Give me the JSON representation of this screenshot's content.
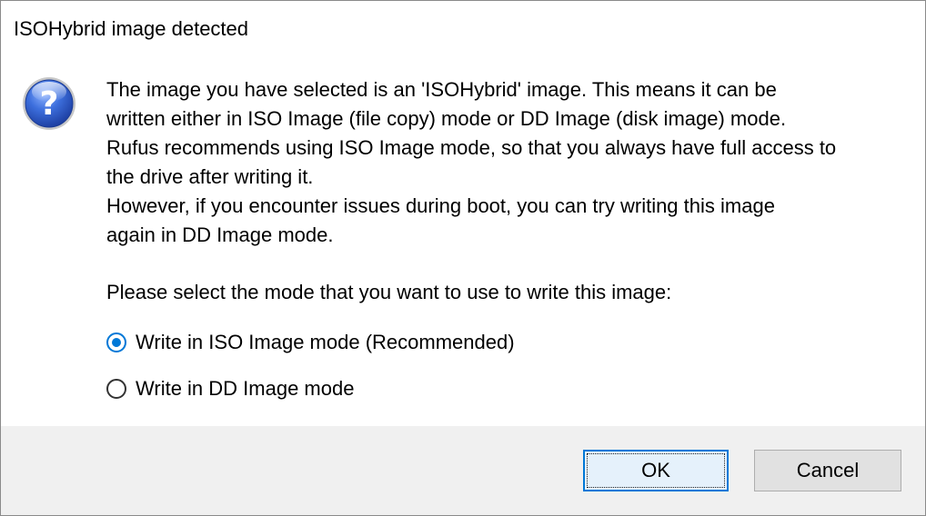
{
  "dialog": {
    "title": "ISOHybrid image detected",
    "icon": "question-icon",
    "message_lines": [
      "The image you have selected is an 'ISOHybrid' image. This means it can be",
      "written either in ISO Image (file copy) mode or DD Image (disk image) mode.",
      "Rufus recommends using ISO Image mode, so that you always have full access to",
      "the drive after writing it.",
      "However, if you encounter issues during boot, you can try writing this image",
      "again in DD Image mode."
    ],
    "prompt": "Please select the mode that you want to use to write this image:",
    "options": [
      {
        "label": "Write in ISO Image mode (Recommended)",
        "selected": true
      },
      {
        "label": "Write in DD Image mode",
        "selected": false
      }
    ],
    "buttons": {
      "ok": "OK",
      "cancel": "Cancel"
    }
  },
  "colors": {
    "accent": "#0078d7",
    "footer_bg": "#f0f0f0",
    "button_bg": "#e1e1e1"
  }
}
